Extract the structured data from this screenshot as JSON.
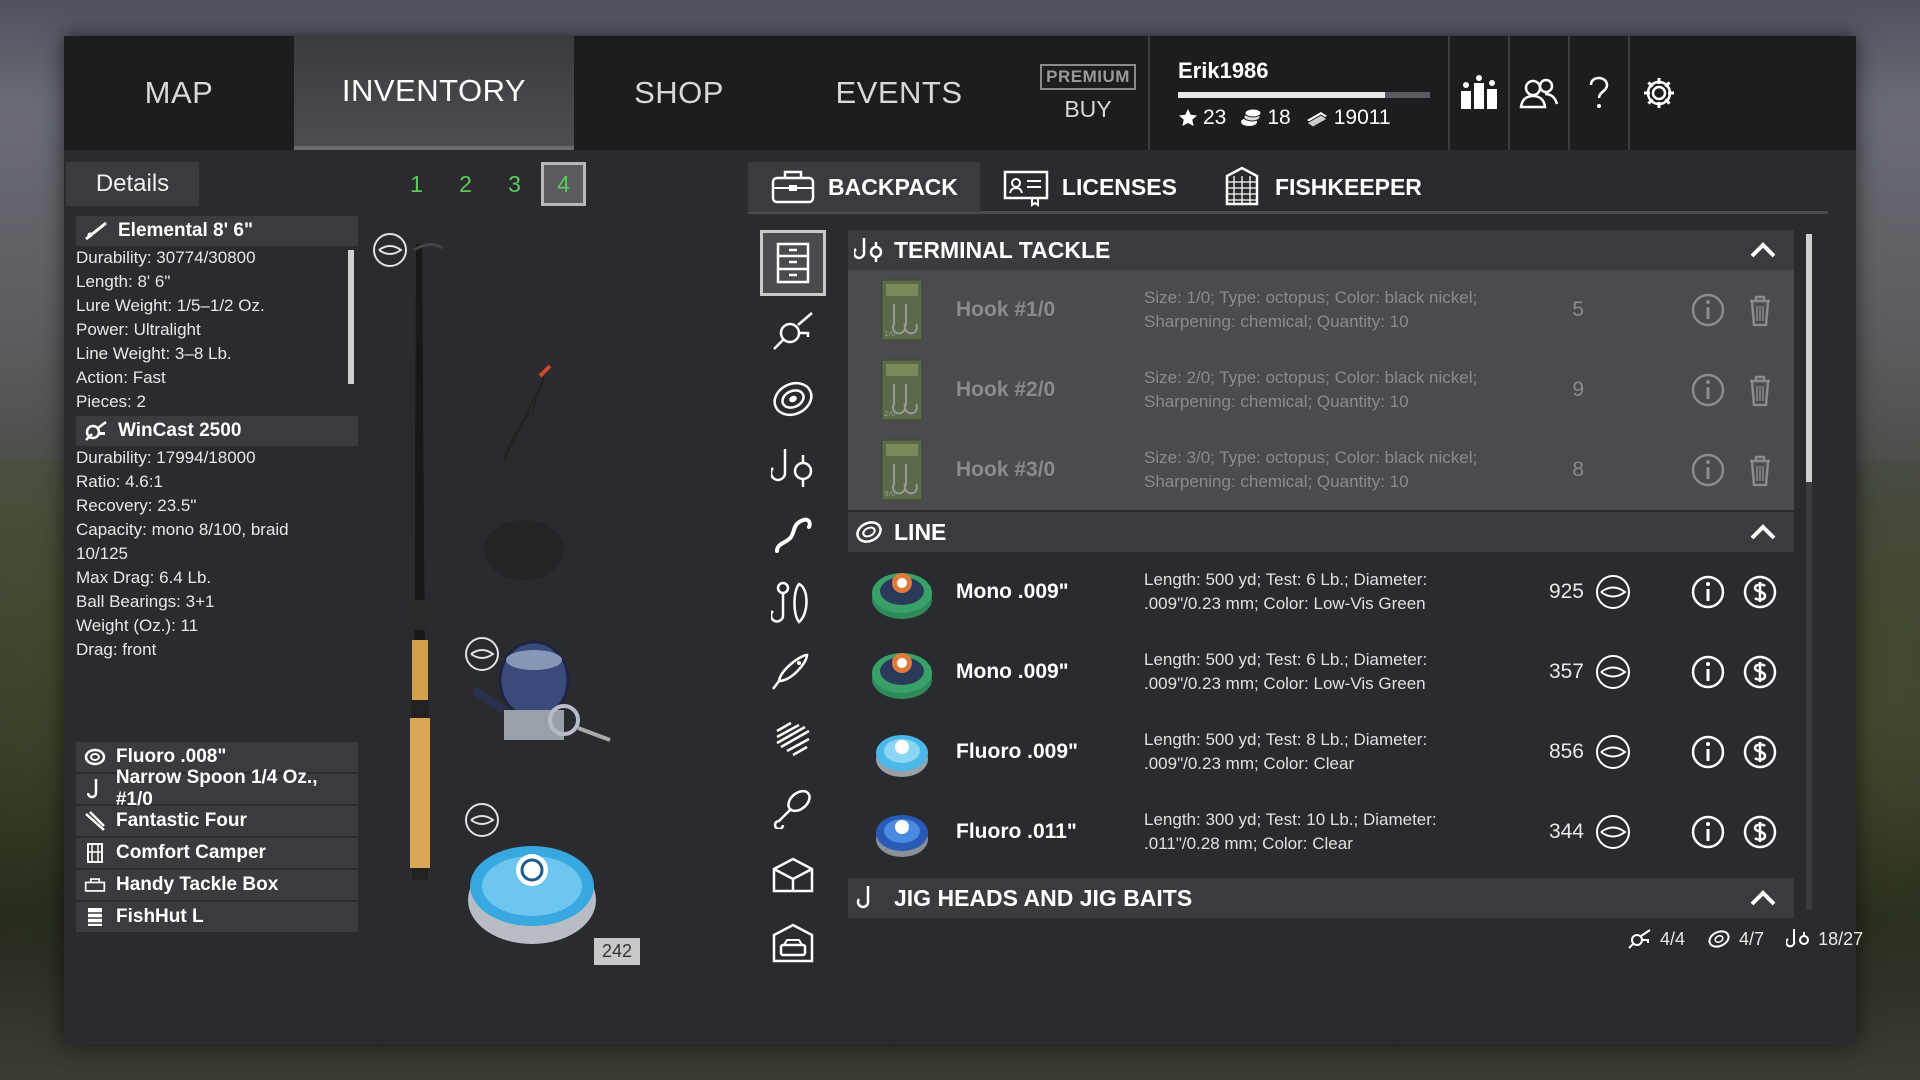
{
  "nav": {
    "tabs": [
      {
        "label": "MAP"
      },
      {
        "label": "INVENTORY"
      },
      {
        "label": "SHOP"
      },
      {
        "label": "EVENTS"
      }
    ],
    "premium_badge": "PREMIUM",
    "premium_buy": "BUY"
  },
  "profile": {
    "name": "Erik1986",
    "xp_fraction": 0.82,
    "stars": "23",
    "silver": "18",
    "money": "19011"
  },
  "left": {
    "details_tab": "Details",
    "slots": [
      "1",
      "2",
      "3",
      "4"
    ],
    "active_slot": "4",
    "rod": {
      "name": "Elemental 8' 6\"",
      "props": [
        "Durability: 30774/30800",
        "Length: 8' 6\"",
        "Lure Weight: 1/5–1/2 Oz.",
        "Power: Ultralight",
        "Line Weight: 3–8 Lb.",
        "Action: Fast",
        "Pieces: 2"
      ]
    },
    "reel": {
      "name": "WinCast 2500",
      "props": [
        "Durability: 17994/18000",
        "Ratio: 4.6:1",
        "Recovery: 23.5\"",
        "Capacity: mono 8/100, braid",
        "10/125",
        "Max Drag: 6.4 Lb.",
        "Ball Bearings: 3+1",
        "Weight (Oz.): 11",
        "Drag: front"
      ]
    },
    "equipment": [
      {
        "label": "Fluoro .008\"",
        "icon": "line-spool-icon"
      },
      {
        "label": "Narrow Spoon 1/4 Oz., #1/0",
        "icon": "hook-icon"
      },
      {
        "label": "Fantastic Four",
        "icon": "rod-pod-icon"
      },
      {
        "label": "Comfort Camper",
        "icon": "chair-icon"
      },
      {
        "label": "Handy Tackle Box",
        "icon": "tackle-box-icon"
      },
      {
        "label": "FishHut L",
        "icon": "keepnet-icon"
      }
    ],
    "line_count": "242"
  },
  "right": {
    "sub_tabs": [
      {
        "label": "BACKPACK",
        "icon": "backpack-icon"
      },
      {
        "label": "LICENSES",
        "icon": "license-icon"
      },
      {
        "label": "FISHKEEPER",
        "icon": "fishkeeper-icon"
      }
    ],
    "categories": [
      {
        "title": "TERMINAL TACKLE",
        "items": [
          {
            "name": "Hook #1/0",
            "desc1": "Size: 1/0; Type: octopus; Color: black nickel;",
            "desc2": "Sharpening: chemical; Quantity: 10",
            "qty": "5",
            "tag": "1/0"
          },
          {
            "name": "Hook #2/0",
            "desc1": "Size: 2/0; Type: octopus; Color: black nickel;",
            "desc2": "Sharpening: chemical; Quantity: 10",
            "qty": "9",
            "tag": "2/0"
          },
          {
            "name": "Hook #3/0",
            "desc1": "Size: 3/0; Type: octopus; Color: black nickel;",
            "desc2": "Sharpening: chemical; Quantity: 10",
            "qty": "8",
            "tag": "3/0"
          }
        ]
      },
      {
        "title": "LINE",
        "items": [
          {
            "name": "Mono .009\"",
            "desc1": "Length: 500 yd; Test: 6 Lb.; Diameter:",
            "desc2": ".009\"/0.23 mm; Color: Low-Vis Green",
            "qty": "925"
          },
          {
            "name": "Mono .009\"",
            "desc1": "Length: 500 yd; Test: 6 Lb.; Diameter:",
            "desc2": ".009\"/0.23 mm; Color: Low-Vis Green",
            "qty": "357"
          },
          {
            "name": "Fluoro .009\"",
            "desc1": "Length: 500 yd; Test: 8 Lb.; Diameter:",
            "desc2": ".009\"/0.23 mm; Color: Clear",
            "qty": "856"
          },
          {
            "name": "Fluoro .011\"",
            "desc1": "Length: 300 yd; Test: 10 Lb.; Diameter:",
            "desc2": ".011\"/0.28 mm; Color: Clear",
            "qty": "344"
          }
        ]
      },
      {
        "title": "JIG HEADS AND JIG BAITS",
        "items": []
      }
    ],
    "capacity": [
      {
        "icon": "reel-icon",
        "value": "4/4"
      },
      {
        "icon": "line-spool-icon",
        "value": "4/7"
      },
      {
        "icon": "terminal-tackle-icon",
        "value": "18/27"
      }
    ]
  },
  "colors": {
    "accent_green": "#5ec95e",
    "panel": "#2a2b2e",
    "header": "#3a3b3e"
  }
}
